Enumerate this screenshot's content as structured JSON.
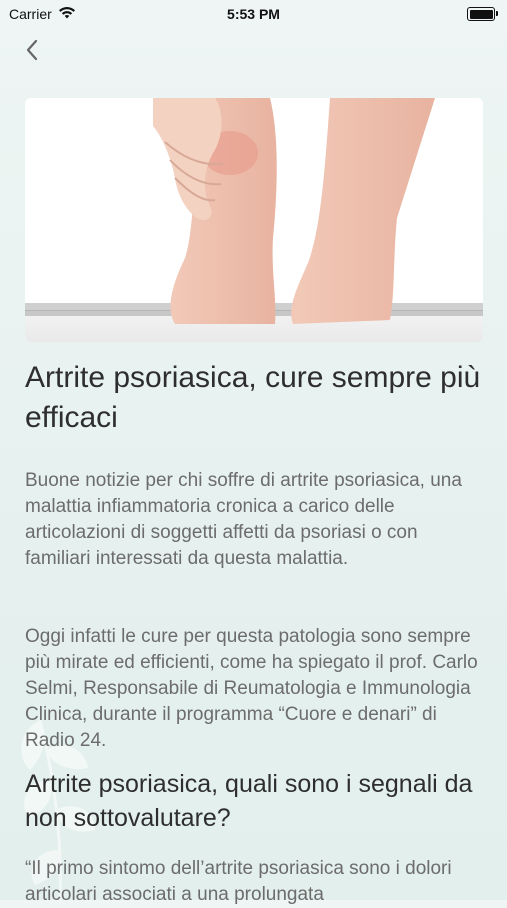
{
  "status_bar": {
    "carrier": "Carrier",
    "time": "5:53 PM"
  },
  "nav": {
    "back_icon": "chevron-left-icon"
  },
  "article": {
    "title": "Artrite psoriasica, cure sempre più efficaci",
    "paragraph_1": "Buone notizie per chi soffre di artrite psoriasica, una malattia infiammatoria cronica a carico delle articolazioni di soggetti affetti da psoriasi o con familiari interessati da questa malattia.",
    "paragraph_2": "Oggi infatti le cure per questa patologia sono sempre più mirate ed efficienti, come ha spiegato il prof. Carlo Selmi, Responsabile di Reumatologia e Immunologia Clinica, durante il programma “Cuore e denari” di Radio 24.",
    "subtitle": "Artrite psoriasica, quali sono i segnali da non sottovalutare?",
    "paragraph_3": "“Il primo sintomo dell’artrite psoriasica sono i dolori articolari associati a una prolungata"
  },
  "colors": {
    "background": "#e6f1ef",
    "text_heading": "#2e2e2e",
    "text_body": "#6c6c6c"
  }
}
